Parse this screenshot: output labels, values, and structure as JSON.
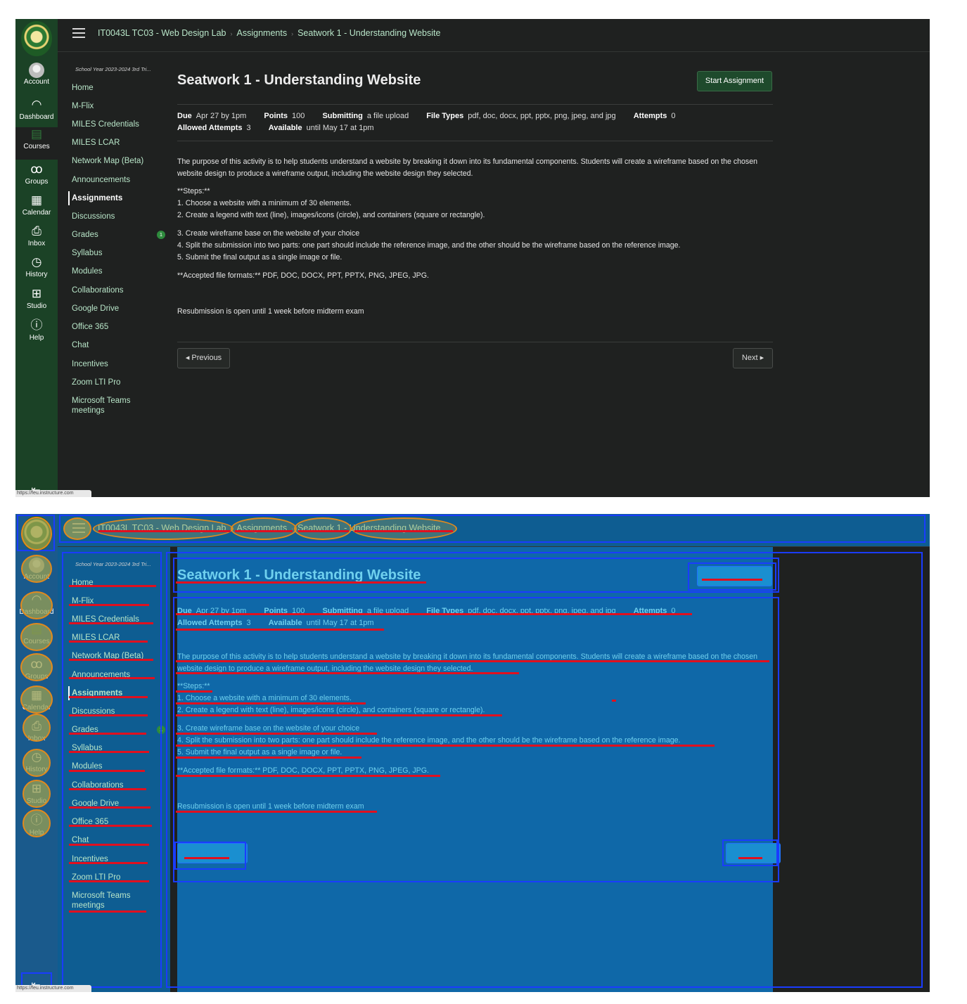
{
  "global_nav": {
    "items": [
      {
        "id": "account",
        "label": "Account",
        "icon": "avatar-icon"
      },
      {
        "id": "dashboard",
        "label": "Dashboard",
        "icon": "dashboard-icon"
      },
      {
        "id": "courses",
        "label": "Courses",
        "icon": "courses-icon",
        "active": true
      },
      {
        "id": "groups",
        "label": "Groups",
        "icon": "groups-icon"
      },
      {
        "id": "calendar",
        "label": "Calendar",
        "icon": "calendar-icon"
      },
      {
        "id": "inbox",
        "label": "Inbox",
        "icon": "inbox-icon"
      },
      {
        "id": "history",
        "label": "History",
        "icon": "history-icon"
      },
      {
        "id": "studio",
        "label": "Studio",
        "icon": "studio-icon"
      },
      {
        "id": "help",
        "label": "Help",
        "icon": "help-icon"
      }
    ],
    "status_url": "https://feu.instructure.com"
  },
  "breadcrumbs": [
    "IT0043L TC03 - Web Design Lab",
    "Assignments",
    "Seatwork 1 - Understanding Website"
  ],
  "course_nav": {
    "term": "School Year 2023-2024 3rd Tri...",
    "items": [
      {
        "label": "Home"
      },
      {
        "label": "M-Flix"
      },
      {
        "label": "MILES Credentials"
      },
      {
        "label": "MILES LCAR"
      },
      {
        "label": "Network Map (Beta)"
      },
      {
        "label": "Announcements"
      },
      {
        "label": "Assignments",
        "active": true
      },
      {
        "label": "Discussions"
      },
      {
        "label": "Grades",
        "badge": "1"
      },
      {
        "label": "Syllabus"
      },
      {
        "label": "Modules"
      },
      {
        "label": "Collaborations"
      },
      {
        "label": "Google Drive"
      },
      {
        "label": "Office 365"
      },
      {
        "label": "Chat"
      },
      {
        "label": "Incentives"
      },
      {
        "label": "Zoom LTI Pro"
      },
      {
        "label": "Microsoft Teams meetings"
      }
    ]
  },
  "assignment": {
    "title": "Seatwork 1 - Understanding Website",
    "start_button": "Start Assignment",
    "meta": {
      "due_label": "Due",
      "due_value": "Apr 27 by 1pm",
      "points_label": "Points",
      "points_value": "100",
      "submitting_label": "Submitting",
      "submitting_value": "a file upload",
      "filetypes_label": "File Types",
      "filetypes_value": "pdf, doc, docx, ppt, pptx, png, jpeg, and jpg",
      "attempts_label": "Attempts",
      "attempts_value": "0",
      "allowed_label": "Allowed Attempts",
      "allowed_value": "3",
      "available_label": "Available",
      "available_value": "until May 17 at 1pm"
    },
    "description": {
      "intro": "The purpose of this activity is to help students understand a website by breaking it down into its fundamental components. Students will create a wireframe based on the chosen website design to produce a wireframe output, including the website design they selected.",
      "steps_heading": "**Steps:**",
      "step1": "1. Choose a website with a minimum of 30 elements.",
      "step2": "2. Create a legend with text (line), images/icons (circle), and containers (square or rectangle).",
      "step3": "3. Create wireframe base on the website of your choice",
      "step4": "4. Split the submission into two parts: one part should include the reference image, and the other should be the wireframe based on the reference image.",
      "step5": "5. Submit the final output as a single image or file.",
      "formats": "**Accepted file formats:** PDF, DOC, DOCX, PPT, PPTX, PNG, JPEG, JPG.",
      "resubmission": "Resubmission is open until 1 week before midterm exam"
    },
    "prev_button": "◂ Previous",
    "next_button": "Next ▸"
  },
  "colors": {
    "global_nav": "#1b4226",
    "background": "#1f2120",
    "link": "#b8e5c8",
    "start_button": "#1e4a2c",
    "overlay_box": "#1a3cff",
    "overlay_line": "#e0101f",
    "overlay_circle": "#e08a1e"
  }
}
